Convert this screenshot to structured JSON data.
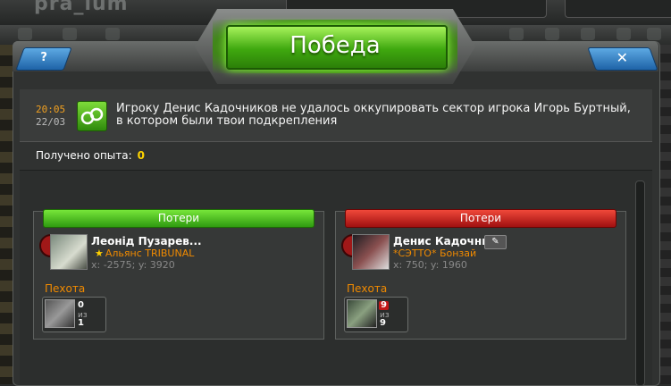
{
  "game": {
    "logo": "pra_ium"
  },
  "dialog": {
    "title": "Победа",
    "help_label": "?",
    "close_label": "✕",
    "message": {
      "time": "20:05",
      "date": "22/03",
      "text": "Игроку Денис Кадочников не удалось оккупировать сектор игрока Игорь Буртный, в котором были твои подкрепления"
    },
    "experience": {
      "label": "Получено опыта:",
      "value": "0"
    },
    "sides": [
      {
        "losses_label": "Потери",
        "player_name": "Леонід Пузарев...",
        "alliance": "Альянс TRIBUNAL",
        "coords": "x: -2575; y: 3920",
        "unit_type": "Пехота",
        "lost": "0",
        "of": "из",
        "total": "1"
      },
      {
        "losses_label": "Потери",
        "player_name": "Денис Кадочни...",
        "alliance": "*СЭТТО* Бонзай",
        "coords": "x: 750; y: 1960",
        "unit_type": "Пехота",
        "lost": "9",
        "of": "из",
        "total": "9",
        "edit_label": "✎"
      }
    ]
  },
  "colors": {
    "victory_green": "#3fa80f",
    "loss_red": "#c21818",
    "accent_orange": "#f08a00",
    "exp_yellow": "#ffd400",
    "button_blue": "#1e63a7"
  }
}
